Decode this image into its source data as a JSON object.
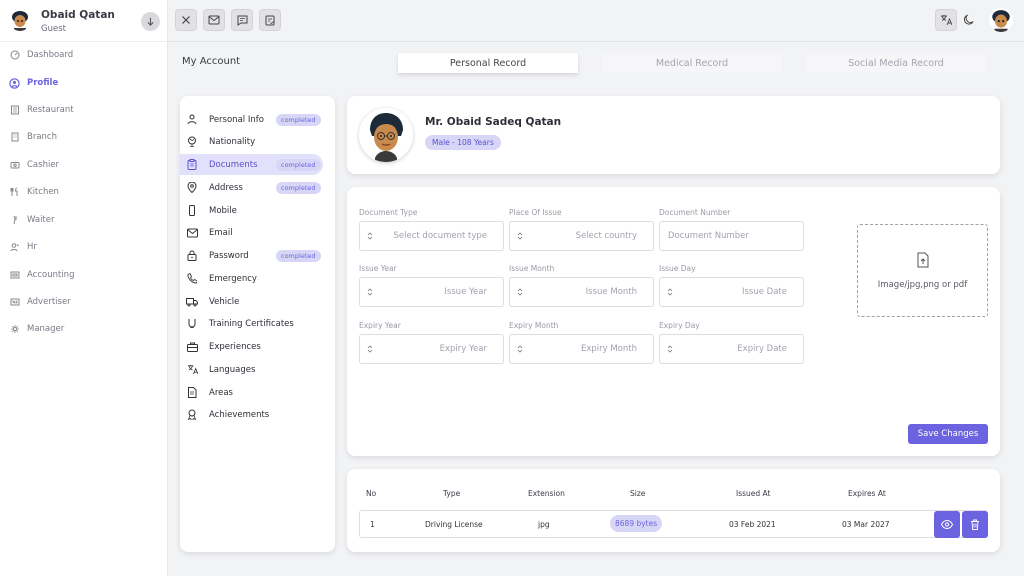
{
  "user": {
    "name": "Obaid Qatan",
    "role": "Guest"
  },
  "nav": [
    {
      "label": "Dashboard",
      "icon": "dashboard-icon"
    },
    {
      "label": "Profile",
      "icon": "profile-icon",
      "active": true
    },
    {
      "label": "Restaurant",
      "icon": "restaurant-icon"
    },
    {
      "label": "Branch",
      "icon": "branch-icon"
    },
    {
      "label": "Cashier",
      "icon": "cashier-icon"
    },
    {
      "label": "Kitchen",
      "icon": "kitchen-icon"
    },
    {
      "label": "Waiter",
      "icon": "waiter-icon"
    },
    {
      "label": "Hr",
      "icon": "hr-icon"
    },
    {
      "label": "Accounting",
      "icon": "accounting-icon"
    },
    {
      "label": "Advertiser",
      "icon": "advertiser-icon"
    },
    {
      "label": "Manager",
      "icon": "manager-icon"
    }
  ],
  "page": {
    "title": "My Account"
  },
  "tabs": [
    "Personal Record",
    "Medical Record",
    "Social Media Record"
  ],
  "sections": [
    {
      "label": "Personal Info",
      "badge": "completed",
      "icon": "person-icon"
    },
    {
      "label": "Nationality",
      "badge": "",
      "icon": "globe-icon"
    },
    {
      "label": "Documents",
      "badge": "completed",
      "icon": "clipboard-icon",
      "active": true
    },
    {
      "label": "Address",
      "badge": "completed",
      "icon": "location-icon"
    },
    {
      "label": "Mobile",
      "badge": "",
      "icon": "mobile-icon"
    },
    {
      "label": "Email",
      "badge": "",
      "icon": "envelope-icon"
    },
    {
      "label": "Password",
      "badge": "completed",
      "icon": "lock-icon"
    },
    {
      "label": "Emergency",
      "badge": "",
      "icon": "phone-icon"
    },
    {
      "label": "Vehicle",
      "badge": "",
      "icon": "truck-icon"
    },
    {
      "label": "Training Certificates",
      "badge": "",
      "icon": "certificate-icon"
    },
    {
      "label": "Experiences",
      "badge": "",
      "icon": "briefcase-icon"
    },
    {
      "label": "Languages",
      "badge": "",
      "icon": "translate-icon"
    },
    {
      "label": "Areas",
      "badge": "",
      "icon": "file-icon"
    },
    {
      "label": "Achievements",
      "badge": "",
      "icon": "award-icon"
    }
  ],
  "profile": {
    "full_name": "Mr. Obaid Sadeq Qatan",
    "gender_age": "Male - 108 Years"
  },
  "form": {
    "document_type": {
      "label": "Document Type",
      "placeholder": "Select document type"
    },
    "place_of_issue": {
      "label": "Place Of Issue",
      "placeholder": "Select country"
    },
    "document_number": {
      "label": "Document Number",
      "placeholder": "Document Number"
    },
    "issue_year": {
      "label": "Issue Year",
      "placeholder": "Issue Year"
    },
    "issue_month": {
      "label": "Issue Month",
      "placeholder": "Issue Month"
    },
    "issue_day": {
      "label": "Issue Day",
      "placeholder": "Issue Date"
    },
    "expiry_year": {
      "label": "Expiry Year",
      "placeholder": "Expiry Year"
    },
    "expiry_month": {
      "label": "Expiry Month",
      "placeholder": "Expiry Month"
    },
    "expiry_day": {
      "label": "Expiry Day",
      "placeholder": "Expiry Date"
    },
    "upload_hint": "Image/jpg,png or pdf",
    "save_label": "Save Changes"
  },
  "table": {
    "headers": [
      "No",
      "Type",
      "Extension",
      "Size",
      "Issued At",
      "Expires At"
    ],
    "rows": [
      {
        "no": "1",
        "type": "Driving License",
        "extension": "jpg",
        "size": "8689 bytes",
        "issued_at": "03 Feb 2021",
        "expires_at": "03 Mar 2027"
      }
    ]
  },
  "colors": {
    "accent": "#6c63e0",
    "badge_bg": "#d8d6f7"
  }
}
